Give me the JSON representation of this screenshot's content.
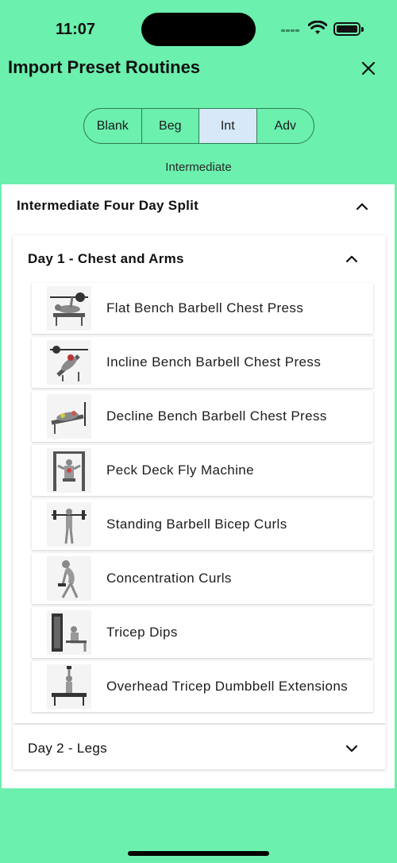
{
  "status_bar": {
    "time": "11:07"
  },
  "header": {
    "title": "Import Preset Routines"
  },
  "segments": [
    {
      "label": "Blank",
      "active": false
    },
    {
      "label": "Beg",
      "active": false
    },
    {
      "label": "Int",
      "active": true
    },
    {
      "label": "Adv",
      "active": false
    }
  ],
  "level_label": "Intermediate",
  "routine": {
    "title": "Intermediate Four Day Split",
    "days": [
      {
        "title": "Day 1 - Chest and Arms",
        "expanded": true,
        "exercises": [
          {
            "name": "Flat Bench Barbell Chest Press"
          },
          {
            "name": "Incline Bench Barbell Chest Press"
          },
          {
            "name": "Decline Bench Barbell Chest Press"
          },
          {
            "name": "Peck Deck Fly Machine"
          },
          {
            "name": "Standing Barbell Bicep Curls"
          },
          {
            "name": "Concentration Curls"
          },
          {
            "name": "Tricep Dips"
          },
          {
            "name": "Overhead Tricep Dumbbell Extensions"
          }
        ]
      },
      {
        "title": "Day 2 - Legs",
        "expanded": false
      }
    ]
  },
  "colors": {
    "background": "#6bf0ad",
    "active_segment": "#d7e8f8",
    "segment_border": "#2e7d55"
  }
}
